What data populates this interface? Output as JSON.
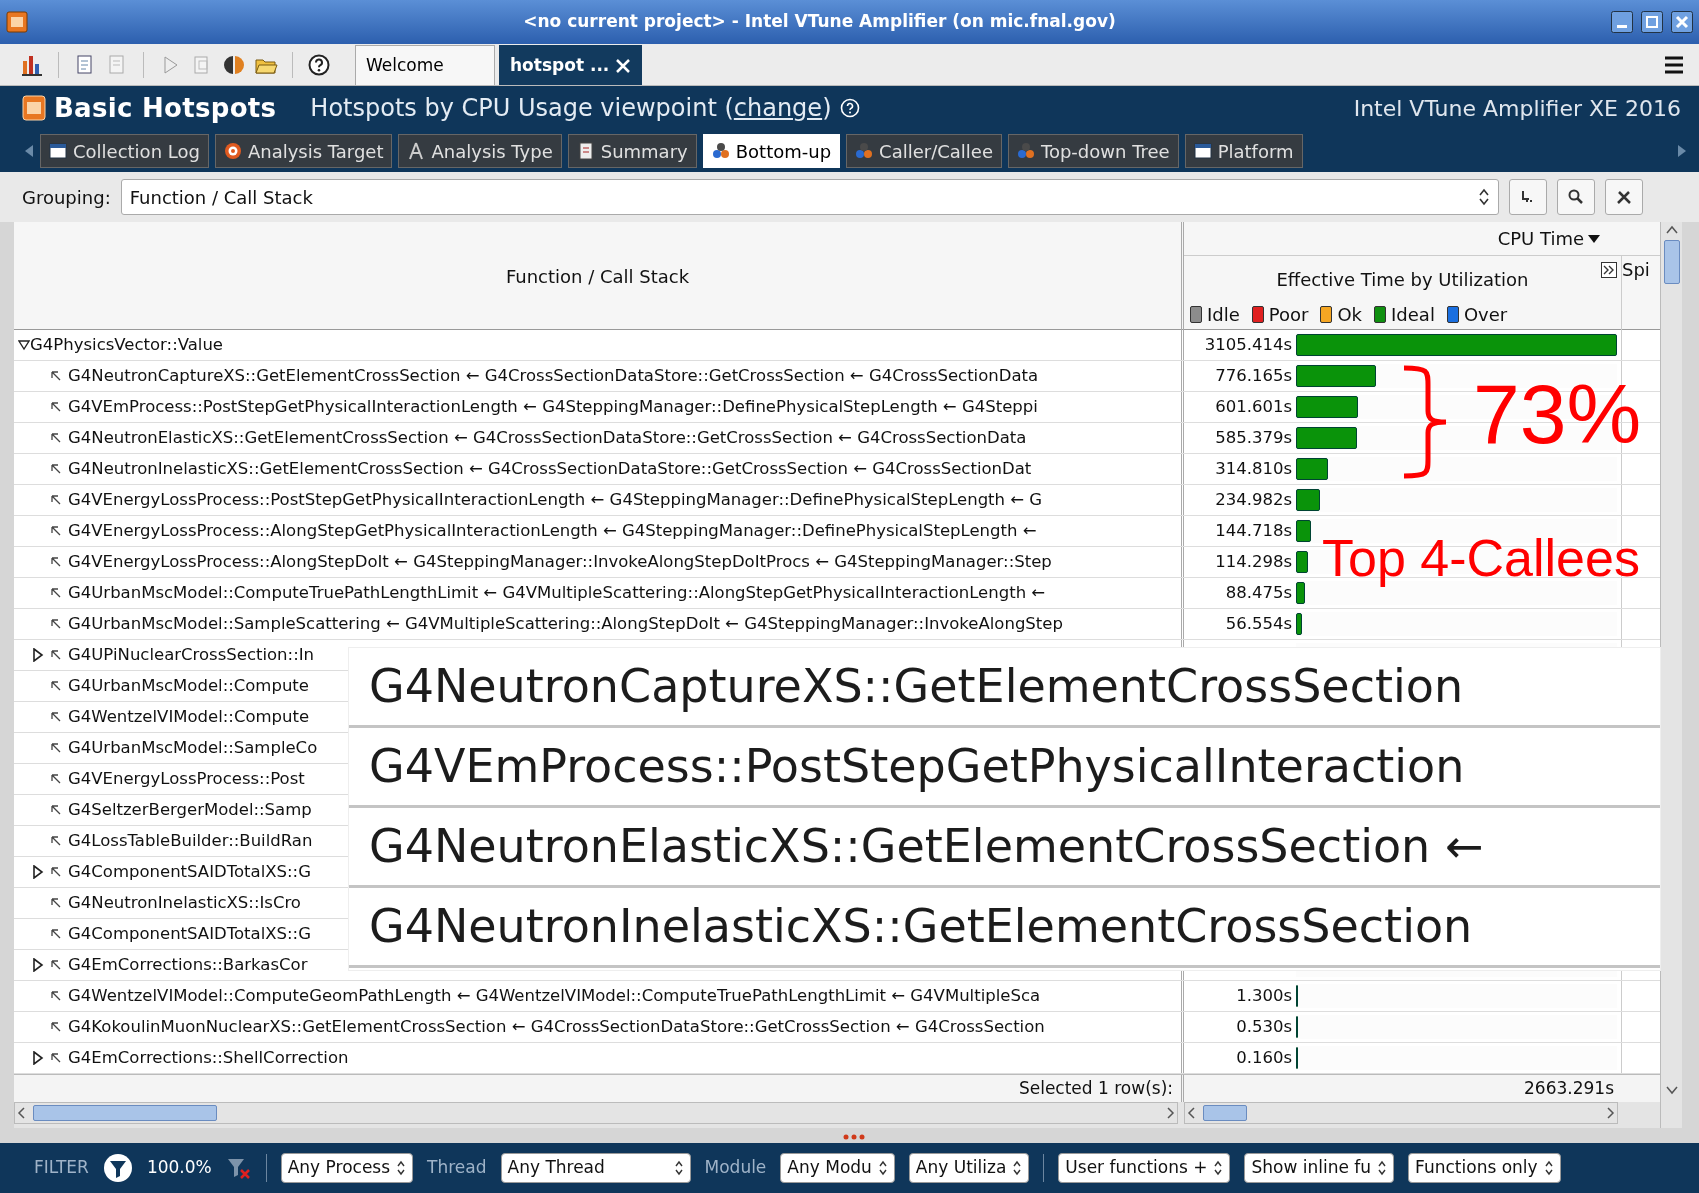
{
  "window": {
    "title": "<no current project> - Intel VTune Amplifier (on mic.fnal.gov)"
  },
  "doc_tabs": [
    {
      "label": "Welcome",
      "selected": false,
      "closable": false
    },
    {
      "label": "hotspot ...",
      "selected": true,
      "closable": true
    }
  ],
  "header": {
    "title": "Basic Hotspots",
    "viewpoint_prefix": "Hotspots by CPU Usage viewpoint (",
    "viewpoint_link": "change",
    "viewpoint_suffix": ")",
    "product": "Intel VTune Amplifier XE 2016"
  },
  "analysis_tabs": [
    {
      "label": "Collection Log",
      "selected": false
    },
    {
      "label": "Analysis Target",
      "selected": false
    },
    {
      "label": "Analysis Type",
      "selected": false
    },
    {
      "label": "Summary",
      "selected": false
    },
    {
      "label": "Bottom-up",
      "selected": true
    },
    {
      "label": "Caller/Callee",
      "selected": false
    },
    {
      "label": "Top-down Tree",
      "selected": false
    },
    {
      "label": "Platform",
      "selected": false
    }
  ],
  "grouping": {
    "label": "Grouping:",
    "value": "Function / Call Stack"
  },
  "table": {
    "column_header": "Function / Call Stack",
    "cpu_time_header": "CPU Time",
    "effective_header": "Effective Time by Utilization",
    "column_3_header": "Spi",
    "legend": [
      {
        "label": "Idle",
        "color": "#8c8c8c"
      },
      {
        "label": "Poor",
        "color": "#e02020"
      },
      {
        "label": "Ok",
        "color": "#f5a623"
      },
      {
        "label": "Ideal",
        "color": "#109010"
      },
      {
        "label": "Over",
        "color": "#1a6fe0"
      }
    ],
    "root": {
      "name": "G4PhysicsVector::Value",
      "expanded": true,
      "time": "3105.414s",
      "level": 1
    },
    "rows": [
      {
        "stack": "G4NeutronCaptureXS::GetElementCrossSection ← G4CrossSectionDataStore::GetCrossSection ← G4CrossSectionData",
        "collapsed": false,
        "time": "776.165s",
        "level": 0.25
      },
      {
        "stack": "G4VEmProcess::PostStepGetPhysicalInteractionLength ← G4SteppingManager::DefinePhysicalStepLength ← G4Steppi",
        "collapsed": false,
        "time": "601.601s",
        "level": 0.194
      },
      {
        "stack": "G4NeutronElasticXS::GetElementCrossSection ← G4CrossSectionDataStore::GetCrossSection ← G4CrossSectionData",
        "collapsed": false,
        "time": "585.379s",
        "level": 0.189
      },
      {
        "stack": "G4NeutronInelasticXS::GetElementCrossSection ← G4CrossSectionDataStore::GetCrossSection ← G4CrossSectionDat",
        "collapsed": false,
        "time": "314.810s",
        "level": 0.101
      },
      {
        "stack": "G4VEnergyLossProcess::PostStepGetPhysicalInteractionLength ← G4SteppingManager::DefinePhysicalStepLength ← G",
        "collapsed": false,
        "time": "234.982s",
        "level": 0.076
      },
      {
        "stack": "G4VEnergyLossProcess::AlongStepGetPhysicalInteractionLength ← G4SteppingManager::DefinePhysicalStepLength ←",
        "collapsed": false,
        "time": "144.718s",
        "level": 0.047
      },
      {
        "stack": "G4VEnergyLossProcess::AlongStepDoIt ← G4SteppingManager::InvokeAlongStepDoItProcs ← G4SteppingManager::Step",
        "collapsed": false,
        "time": "114.298s",
        "level": 0.037
      },
      {
        "stack": "G4UrbanMscModel::ComputeTruePathLengthLimit ← G4VMultipleScattering::AlongStepGetPhysicalInteractionLength ←",
        "collapsed": false,
        "time": "88.475s",
        "level": 0.028
      },
      {
        "stack": "G4UrbanMscModel::SampleScattering ← G4VMultipleScattering::AlongStepDoIt ← G4SteppingManager::InvokeAlongStep",
        "collapsed": false,
        "time": "56.554s",
        "level": 0.018
      },
      {
        "stack": "G4UPiNuclearCrossSection::In",
        "collapsed": true
      },
      {
        "stack": "G4UrbanMscModel::Compute",
        "collapsed": false
      },
      {
        "stack": "G4WentzelVIModel::Compute",
        "collapsed": false
      },
      {
        "stack": "G4UrbanMscModel::SampleCo",
        "collapsed": false
      },
      {
        "stack": "G4VEnergyLossProcess::Post",
        "collapsed": false
      },
      {
        "stack": "G4SeltzerBergerModel::Samp",
        "collapsed": false
      },
      {
        "stack": "G4LossTableBuilder::BuildRan",
        "collapsed": false
      },
      {
        "stack": "G4ComponentSAIDTotalXS::G",
        "collapsed": true
      },
      {
        "stack": "G4NeutronInelasticXS::IsCro",
        "collapsed": false
      },
      {
        "stack": "G4ComponentSAIDTotalXS::G",
        "collapsed": false
      },
      {
        "stack": "G4EmCorrections::BarkasCor",
        "collapsed": true
      },
      {
        "stack": "G4WentzelVIModel::ComputeGeomPathLength ← G4WentzelVIModel::ComputeTruePathLengthLimit ← G4VMultipleSca",
        "collapsed": false,
        "time": "1.300s",
        "level": 0.0004
      },
      {
        "stack": "G4KokoulinMuonNuclearXS::GetElementCrossSection ← G4CrossSectionDataStore::GetCrossSection ← G4CrossSection",
        "collapsed": false,
        "time": "0.530s",
        "level": 0.0002
      },
      {
        "stack": "G4EmCorrections::ShellCorrection",
        "collapsed": true,
        "time": "0.160s",
        "level": 0.0001
      }
    ],
    "selected_label": "Selected 1 row(s):",
    "selected_total": "2663.291s"
  },
  "zoom_inset": {
    "lines": [
      "G4NeutronCaptureXS::GetElementCrossSection",
      "G4VEmProcess::PostStepGetPhysicalInteraction",
      "G4NeutronElasticXS::GetElementCrossSection ←",
      "G4NeutronInelasticXS::GetElementCrossSection"
    ]
  },
  "annotations": {
    "brace_label": "73%",
    "callout": "Top 4-Callees"
  },
  "filter_bar": {
    "label": "FILTER",
    "percent": "100.0%",
    "items": [
      {
        "kind": "divider"
      },
      {
        "kind": "select",
        "text": "Any Process"
      },
      {
        "kind": "label",
        "text": "Thread"
      },
      {
        "kind": "select",
        "text": "Any Thread",
        "wide": true
      },
      {
        "kind": "label",
        "text": "Module"
      },
      {
        "kind": "select",
        "text": "Any Modu"
      },
      {
        "kind": "select",
        "text": "Any Utiliza"
      },
      {
        "kind": "divider"
      },
      {
        "kind": "select",
        "text": "User functions +"
      },
      {
        "kind": "select",
        "text": "Show inline fu"
      },
      {
        "kind": "select",
        "text": "Functions only"
      }
    ]
  }
}
